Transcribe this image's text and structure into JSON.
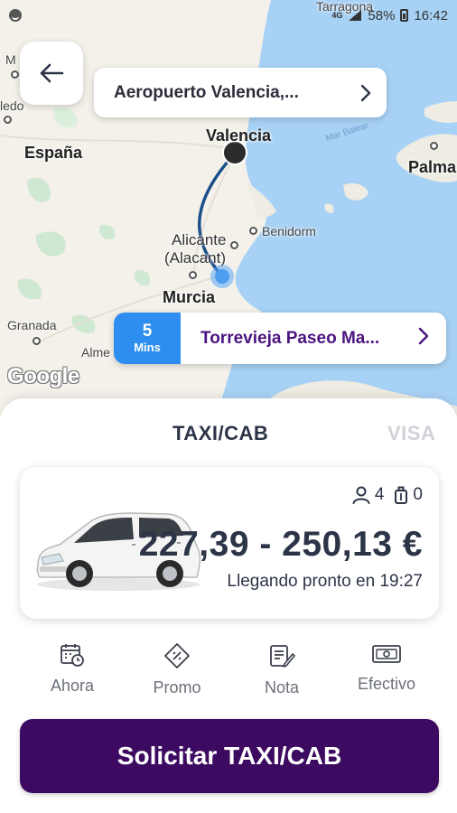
{
  "status_bar": {
    "network": "4G",
    "battery": "58%",
    "time": "16:42"
  },
  "map": {
    "labels": {
      "valencia": "Valencia",
      "espana": "España",
      "palma": "Palma",
      "benidorm": "Benidorm",
      "alicante": "Alicante",
      "alacant": "(Alacant)",
      "murcia": "Murcia",
      "granada": "Granada",
      "almeria": "Alme",
      "ledo": "ledo",
      "m": "M",
      "tarragona": "Tarragona",
      "sea": "Mar Balear"
    },
    "attribution": "Google"
  },
  "destination": {
    "label": "Aeropuerto Valencia,..."
  },
  "origin": {
    "eta_value": "5",
    "eta_unit": "Mins",
    "label": "Torrevieja Paseo Ma..."
  },
  "tabs": {
    "active": "TAXI/CAB",
    "inactive": "VISA"
  },
  "vehicle": {
    "passengers": "4",
    "luggage": "0",
    "price": "227,39  - 250,13 €",
    "arrival": "Llegando pronto en 19:27"
  },
  "options": [
    {
      "label": "Ahora",
      "icon": "calendar-clock-icon"
    },
    {
      "label": "Promo",
      "icon": "promo-tag-icon"
    },
    {
      "label": "Nota",
      "icon": "note-edit-icon"
    },
    {
      "label": "Efectivo",
      "icon": "cash-icon"
    }
  ],
  "cta": {
    "label": "Solicitar TAXI/CAB"
  },
  "colors": {
    "primary": "#3d0a61",
    "eta_blue": "#2d8ef0",
    "route": "#1b4f8a",
    "text_dark": "#2c3447",
    "origin_text": "#4b1480"
  }
}
